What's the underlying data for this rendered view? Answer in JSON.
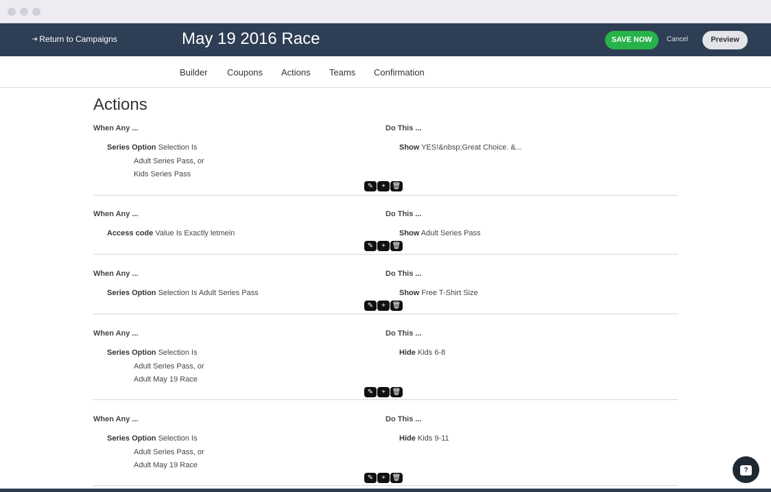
{
  "header": {
    "return_label": "Return to Campaigns",
    "return_icon": "sign-in-icon",
    "title": "May 19 2016 Race",
    "save_label": "SAVE NOW",
    "cancel_label": "Cancel",
    "preview_label": "Preview",
    "bg_color": "#2e3f55",
    "save_color": "#27b24a"
  },
  "tabs": [
    {
      "label": "Builder"
    },
    {
      "label": "Coupons"
    },
    {
      "label": "Actions"
    },
    {
      "label": "Teams"
    },
    {
      "label": "Confirmation"
    }
  ],
  "page": {
    "title": "Actions",
    "when_label": "When Any ...",
    "do_label": "Do This ..."
  },
  "rules": [
    {
      "field": "Series Option",
      "condition": "Selection Is",
      "options": [
        "Adult Series Pass, or",
        "Kids Series Pass"
      ],
      "verb": "Show",
      "target": "YES!&nbsp;Great Choice. &..."
    },
    {
      "field": "Access code",
      "condition": "Value Is Exactly letmein",
      "options": [],
      "verb": "Show",
      "target": "Adult Series Pass"
    },
    {
      "field": "Series Option",
      "condition": "Selection Is Adult Series Pass",
      "options": [],
      "verb": "Show",
      "target": "Free T-Shirt Size"
    },
    {
      "field": "Series Option",
      "condition": "Selection Is",
      "options": [
        "Adult Series Pass, or",
        "Adult May 19 Race"
      ],
      "verb": "Hide",
      "target": "Kids 6-8"
    },
    {
      "field": "Series Option",
      "condition": "Selection Is",
      "options": [
        "Adult Series Pass, or",
        "Adult May 19 Race"
      ],
      "verb": "Hide",
      "target": "Kids 9-11"
    }
  ],
  "rule_buttons": [
    {
      "icon": "pencil-icon",
      "glyph": "✎",
      "name": "edit-rule-button"
    },
    {
      "icon": "plus-icon",
      "glyph": "+",
      "name": "add-rule-button"
    },
    {
      "icon": "trash-icon",
      "glyph": "🗑",
      "name": "delete-rule-button"
    }
  ],
  "help": {
    "icon": "chat-help-icon",
    "glyph": "?"
  }
}
